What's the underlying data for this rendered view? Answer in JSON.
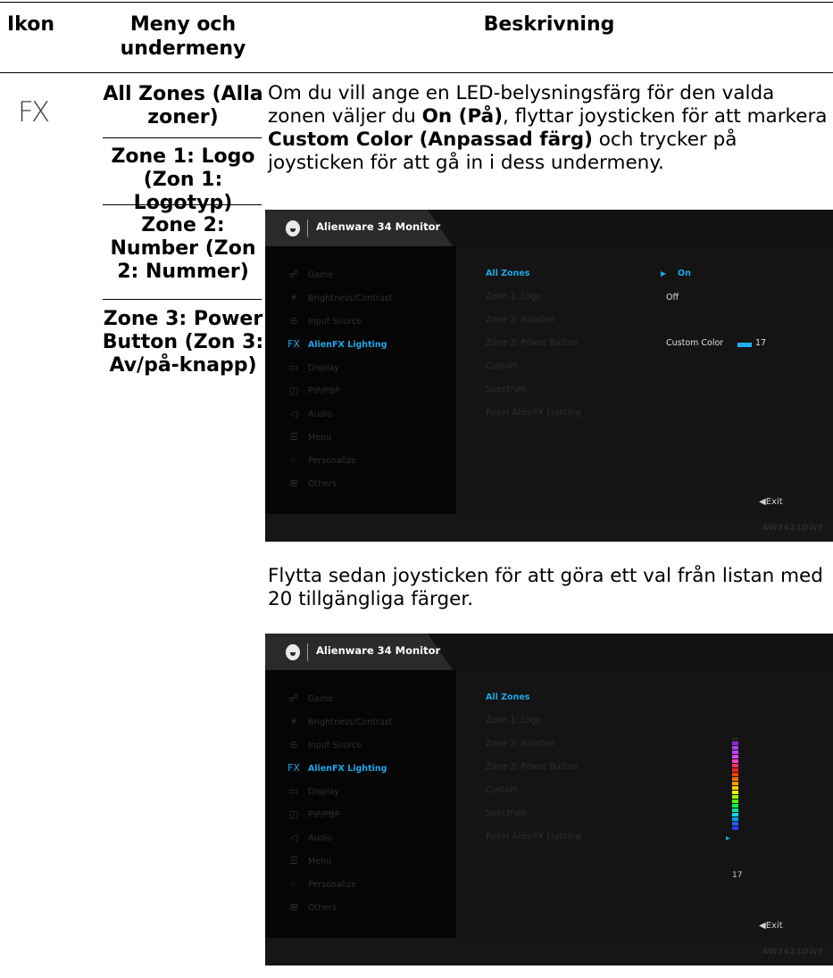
{
  "header": {
    "col1": "Ikon",
    "col2": "Meny och undermeny",
    "col3": "Beskrivning"
  },
  "icon": {
    "name": "alienfx-icon",
    "glyph": "FX"
  },
  "zones": [
    "All Zones (Alla zoner)",
    "Zone 1: Logo (Zon 1: Logotyp)",
    "Zone 2: Number (Zon 2: Nummer)",
    "Zone 3: Power Button (Zon 3: Av/på-knapp)"
  ],
  "desc1": {
    "a": "Om du vill ange en LED-belysningsfärg för den valda zonen väljer du ",
    "b": "On (På)",
    "c": ", flyttar joysticken för att markera ",
    "d": "Custom Color (Anpassad färg)",
    "e": " och trycker på joysticken för att gå in i dess undermeny."
  },
  "desc2": "Flytta sedan joysticken för att göra ett val från listan med 20 tillgängliga färger.",
  "osd": {
    "title": "Alienware 34 Monitor",
    "model": "AW3423DWF",
    "menu": [
      {
        "label": "Game",
        "icon": "gamepad-icon"
      },
      {
        "label": "Brightness/Contrast",
        "icon": "sun-icon"
      },
      {
        "label": "Input Source",
        "icon": "input-icon"
      },
      {
        "label": "AlienFX Lighting",
        "icon": "alienfx-icon"
      },
      {
        "label": "Display",
        "icon": "monitor-icon"
      },
      {
        "label": "PIP/PBP",
        "icon": "pip-icon"
      },
      {
        "label": "Audio",
        "icon": "speaker-icon"
      },
      {
        "label": "Menu",
        "icon": "menu-icon"
      },
      {
        "label": "Personalize",
        "icon": "star-icon"
      },
      {
        "label": "Others",
        "icon": "others-icon"
      }
    ],
    "active_menu": "AlienFX Lighting",
    "submenu": [
      "All Zones",
      "Zone 1: Logo",
      "Zone 2: Number",
      "Zone 3: Power Button",
      "Custom",
      "Spectrum",
      "Reset AlienFX Lighting"
    ],
    "active_submenu": "All Zones",
    "options": {
      "on": "On",
      "off": "Off",
      "custom_color": "Custom Color",
      "custom_value": "17"
    },
    "exit": "◀Exit",
    "slider_value": "17",
    "slider_colors": [
      "#222222",
      "#8a2be2",
      "#a040ff",
      "#c040ff",
      "#e040ff",
      "#ff40c0",
      "#ff3060",
      "#ff2020",
      "#ff4000",
      "#ff7000",
      "#ffa000",
      "#ffd000",
      "#e8ff00",
      "#a0ff00",
      "#50ff00",
      "#00ff40",
      "#00e0a0",
      "#00d8f0",
      "#00a0ff",
      "#2060ff",
      "#2a3aff"
    ],
    "slider_selected_index": 17,
    "accent": "#1da6e6"
  }
}
